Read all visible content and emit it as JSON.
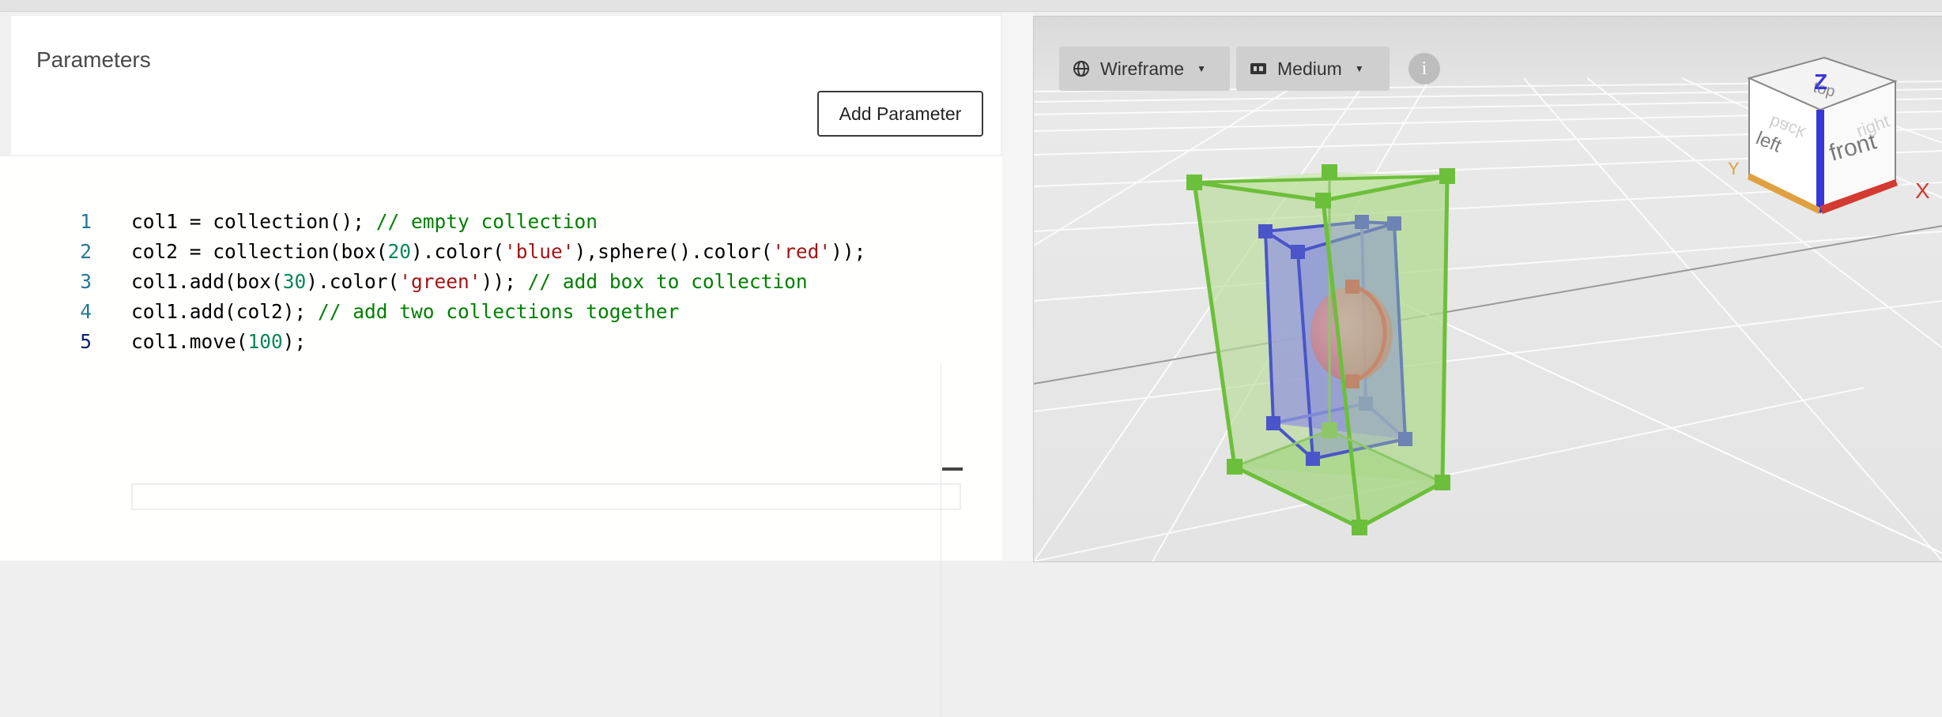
{
  "parameters": {
    "title": "Parameters",
    "add_button_label": "Add Parameter"
  },
  "editor": {
    "lines": [
      {
        "number": "1",
        "tokens": [
          {
            "t": "col1 = collection(); ",
            "c": "plain"
          },
          {
            "t": "// empty collection",
            "c": "comment"
          }
        ]
      },
      {
        "number": "2",
        "tokens": [
          {
            "t": "col2 = collection(box(",
            "c": "plain"
          },
          {
            "t": "20",
            "c": "number"
          },
          {
            "t": ").color(",
            "c": "plain"
          },
          {
            "t": "'blue'",
            "c": "string"
          },
          {
            "t": "),sphere().color(",
            "c": "plain"
          },
          {
            "t": "'red'",
            "c": "string"
          },
          {
            "t": "));",
            "c": "plain"
          }
        ]
      },
      {
        "number": "3",
        "tokens": [
          {
            "t": "col1.add(box(",
            "c": "plain"
          },
          {
            "t": "30",
            "c": "number"
          },
          {
            "t": ").color(",
            "c": "plain"
          },
          {
            "t": "'green'",
            "c": "string"
          },
          {
            "t": ")); ",
            "c": "plain"
          },
          {
            "t": "// add box to collection",
            "c": "comment"
          }
        ]
      },
      {
        "number": "4",
        "tokens": [
          {
            "t": "col1.add(col2); ",
            "c": "plain"
          },
          {
            "t": "// add two collections together",
            "c": "comment"
          }
        ]
      },
      {
        "number": "5",
        "tokens": [
          {
            "t": "col1.move(",
            "c": "plain"
          },
          {
            "t": "100",
            "c": "number"
          },
          {
            "t": ");",
            "c": "plain"
          }
        ]
      }
    ],
    "active_line": "5"
  },
  "viewport": {
    "render_mode": "Wireframe",
    "quality": "Medium",
    "info_label": "i",
    "nav_cube": {
      "top": "top",
      "front": "front",
      "left": "left",
      "right": "right",
      "back": "back",
      "axis_x": "X",
      "axis_y": "Y",
      "axis_z": "Z"
    }
  },
  "colors": {
    "green_box": "#6cbf3a",
    "blue_box": "#4a55c9",
    "red_sphere": "#d45b5b",
    "axis_x": "#d23a32",
    "axis_y": "#e0a040",
    "axis_z": "#3a36d8"
  }
}
